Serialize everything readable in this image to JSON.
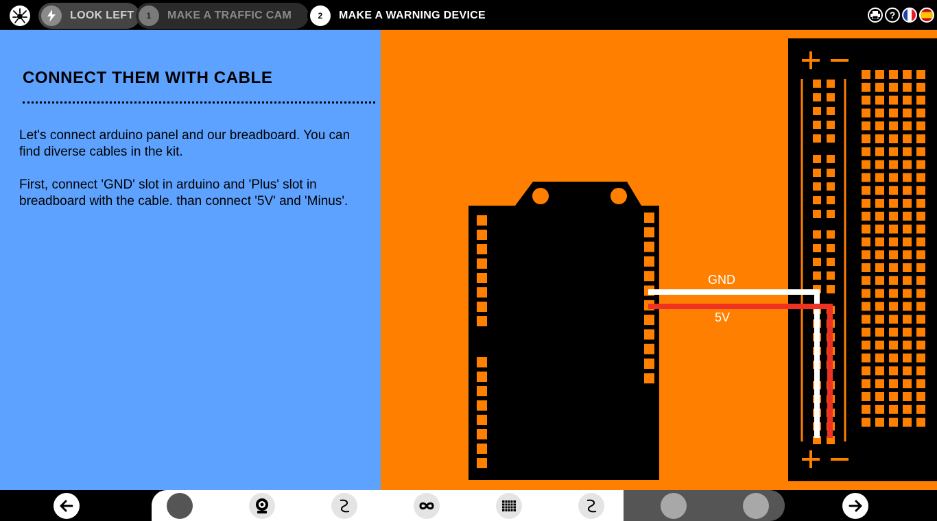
{
  "app": {
    "logo_icon": "bug-logo-icon"
  },
  "steps": [
    {
      "badge": "⚡",
      "label": "LOOK LEFT",
      "state": "done"
    },
    {
      "badge": "1",
      "label": "MAKE A TRAFFIC CAM",
      "state": "inactive"
    },
    {
      "badge": "2",
      "label": "MAKE A WARNING DEVICE",
      "state": "active"
    }
  ],
  "top_icons": [
    {
      "name": "print-icon",
      "glyph": "⎙"
    },
    {
      "name": "help-icon",
      "glyph": "?"
    },
    {
      "name": "flag-france-icon"
    },
    {
      "name": "flag-spain-icon"
    }
  ],
  "instruction": {
    "title": "CONNECT THEM WITH CABLE",
    "paragraph1": "Let's connect arduino panel and our breadboard. You can find diverse cables in the kit.",
    "paragraph2": "First, connect 'GND' slot in arduino and 'Plus' slot in breadboard with the cable. than connect '5V' and 'Minus'."
  },
  "diagram": {
    "wire_gnd_label": "GND",
    "wire_5v_label": "5V",
    "wire_gnd_color": "#ffffff",
    "wire_5v_color": "#ee3322",
    "plus_sign": "+",
    "minus_sign": "−"
  },
  "colors": {
    "left_bg": "#5ea2ff",
    "right_bg": "#ff7f00",
    "board": "#000000",
    "pin": "#ff7f00"
  },
  "bottom": {
    "prev_icon": "arrow-left-icon",
    "next_icon": "arrow-right-icon",
    "tools": [
      "selected-dot-icon",
      "webcam-icon",
      "cable-icon",
      "arduino-infinity-icon",
      "breadboard-icon",
      "cable-icon",
      "locked-dot-icon",
      "locked-dot-icon"
    ]
  }
}
